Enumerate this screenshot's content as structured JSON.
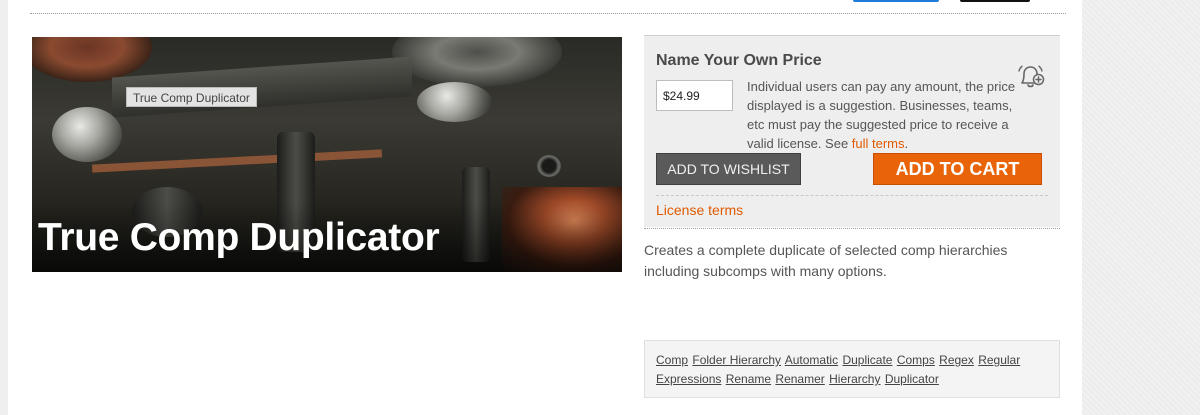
{
  "hero": {
    "tag_label": "True Comp Duplicator",
    "title": "True Comp Duplicator"
  },
  "price_panel": {
    "title": "Name Your Own Price",
    "price_value": "$24.99",
    "description": "Individual users can pay any amount, the price displayed is a suggestion. Businesses, teams, etc must pay the suggested price to receive a valid license. See ",
    "full_terms_link": "full terms",
    "description_end": ".",
    "wishlist_button": "ADD TO WISHLIST",
    "cart_button": "ADD TO CART",
    "license_terms_link": "License terms",
    "icons": {
      "notify": "bell-plus-icon"
    }
  },
  "description": "Creates a complete duplicate of selected comp hierarchies including subcomps with many options.",
  "tags": [
    "Comp",
    "Folder Hierarchy",
    "Automatic",
    "Duplicate",
    "Comps",
    "Regex",
    "Regular Expressions",
    "Rename",
    "Renamer",
    "Hierarchy",
    "Duplicator"
  ],
  "colors": {
    "accent": "#e96408",
    "link": "#e05a00",
    "wishlist_bg": "#5a5a5a",
    "panel_bg": "#eeeeee"
  }
}
